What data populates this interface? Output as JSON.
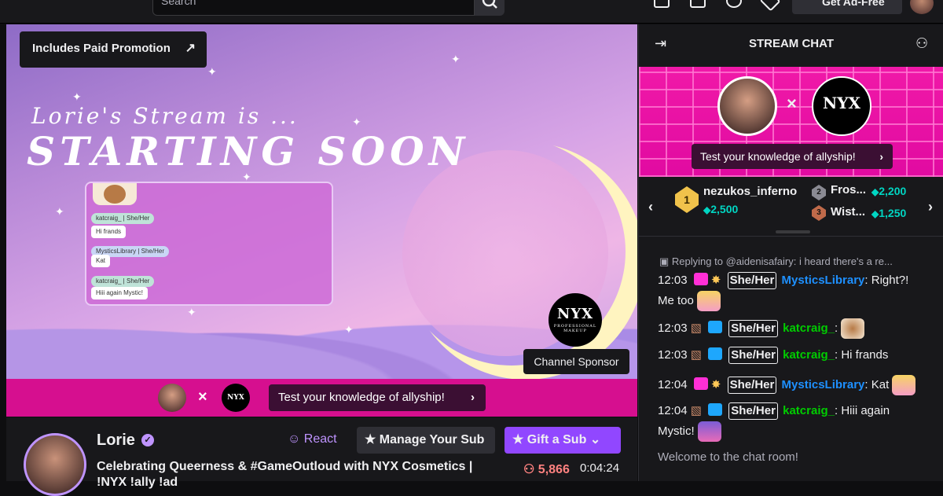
{
  "topbar": {
    "search_placeholder": "Search",
    "adfree_label": "Get Ad-Free"
  },
  "player": {
    "promo_label": "Includes Paid Promotion",
    "title_line1": "Lorie's Stream is ...",
    "title_line2": "STARTING SOON",
    "overlay_chat": [
      {
        "user": "katcraig_ | She/Her",
        "text": "Hi frands"
      },
      {
        "user": "MysticsLibrary | She/Her",
        "text": "Kat"
      },
      {
        "user": "katcraig_ | She/Her",
        "text": "Hiii again Mystic!"
      }
    ],
    "nyx_logo": "NYX",
    "nyx_sub": "PROFESSIONAL MAKEUP",
    "sponsor_label": "Channel Sponsor"
  },
  "banner": {
    "x": "×",
    "nyx": "NYX",
    "cta": "Test your knowledge of allyship!",
    "chevron": "›"
  },
  "channel": {
    "name": "Lorie",
    "verified": "✓",
    "title_line1": "Celebrating Queerness & #GameOutloud with NYX Cosmetics |",
    "title_line2": "!NYX !ally !ad",
    "react_label": "React",
    "manage_label": "Manage Your Sub",
    "gift_label": "Gift a Sub",
    "viewers": "5,866",
    "uptime": "0:04:24"
  },
  "chat": {
    "title": "STREAM CHAT",
    "banner_x": "×",
    "banner_nyx": "NYX",
    "banner_cta": "Test your knowledge of allyship!",
    "leaderboard": [
      {
        "rank": "1",
        "name": "nezukos_inferno",
        "amount": "2,500"
      },
      {
        "rank": "2",
        "name": "Fros...",
        "amount": "2,200"
      },
      {
        "rank": "3",
        "name": "Wist...",
        "amount": "1,250"
      }
    ],
    "reply_text": "Replying to @aidenisafairy: i heard there's a re...",
    "messages": [
      {
        "time": "12:03",
        "pronoun": "She/Her",
        "user": "MysticsLibrary",
        "text": ": Right?!",
        "text2": "Me too"
      },
      {
        "time": "12:03",
        "pronoun": "She/Her",
        "user": "katcraig_",
        "text": ":"
      },
      {
        "time": "12:03",
        "pronoun": "She/Her",
        "user": "katcraig_",
        "text": ": Hi frands"
      },
      {
        "time": "12:04",
        "pronoun": "She/Her",
        "user": "MysticsLibrary",
        "text": ": Kat"
      },
      {
        "time": "12:04",
        "pronoun": "She/Her",
        "user": "katcraig_",
        "text": ": Hiii again",
        "text2": "Mystic!"
      }
    ],
    "welcome": "Welcome to the chat room!"
  },
  "colors": {
    "accent": "#9147ff",
    "banner_pink": "#d60f8f",
    "username_blue": "#1e90ff",
    "username_green": "#00cc00",
    "bits": "#00d6c3"
  }
}
